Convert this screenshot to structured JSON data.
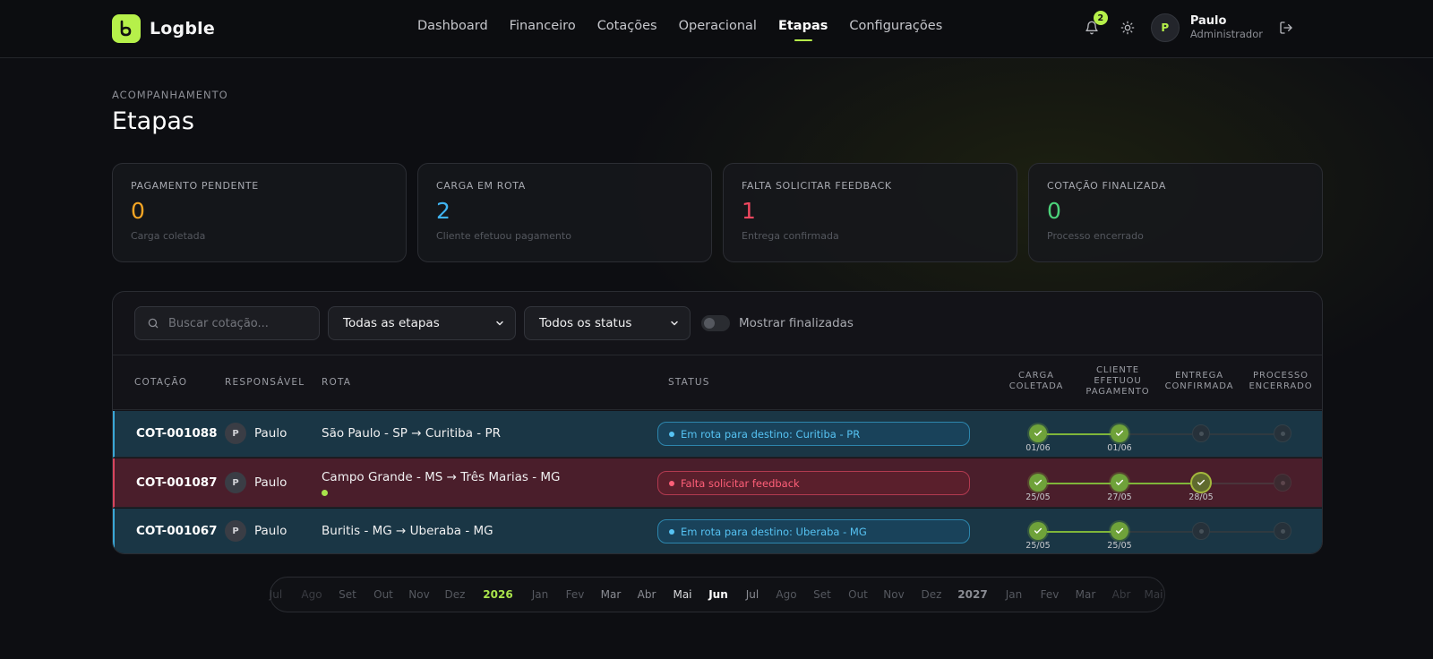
{
  "app": {
    "name": "Logble",
    "logo_icon": "logble-logo-icon",
    "accent": "#b6f04a"
  },
  "nav": {
    "items": [
      {
        "label": "Dashboard",
        "active": false
      },
      {
        "label": "Financeiro",
        "active": false
      },
      {
        "label": "Cotações",
        "active": false
      },
      {
        "label": "Operacional",
        "active": false
      },
      {
        "label": "Etapas",
        "active": true
      },
      {
        "label": "Configurações",
        "active": false
      }
    ]
  },
  "header": {
    "notifications_count": "2",
    "user": {
      "initial": "P",
      "name": "Paulo",
      "role": "Administrador"
    }
  },
  "page": {
    "kicker": "ACOMPANHAMENTO",
    "title": "Etapas"
  },
  "cards": [
    {
      "label": "PAGAMENTO PENDENTE",
      "value": "0",
      "sub": "Carga coletada",
      "color": "#f5a524"
    },
    {
      "label": "CARGA EM ROTA",
      "value": "2",
      "sub": "Cliente efetuou pagamento",
      "color": "#3fb3f0"
    },
    {
      "label": "FALTA SOLICITAR FEEDBACK",
      "value": "1",
      "sub": "Entrega confirmada",
      "color": "#f0475f"
    },
    {
      "label": "COTAÇÃO FINALIZADA",
      "value": "0",
      "sub": "Processo encerrado",
      "color": "#4cd27a"
    }
  ],
  "filters": {
    "search_placeholder": "Buscar cotação...",
    "stage_select": "Todas as etapas",
    "status_select": "Todos os status",
    "toggle_label": "Mostrar finalizadas"
  },
  "table": {
    "headers": {
      "cotacao": "COTAÇÃO",
      "responsavel": "RESPONSÁVEL",
      "rota": "ROTA",
      "status": "STATUS"
    },
    "stage_headers": [
      "CARGA\nCOLETADA",
      "CLIENTE\nEFETUOU\nPAGAMENTO",
      "ENTREGA\nCONFIRMADA",
      "PROCESSO\nENCERRADO"
    ],
    "rows": [
      {
        "code": "COT-001088",
        "resp_initial": "P",
        "resp_name": "Paulo",
        "route": "São Paulo - SP → Curitiba - PR",
        "status": "Em rota para destino: Curitiba - PR",
        "tone": "blue",
        "stages": [
          "done",
          "done",
          "todo",
          "todo"
        ],
        "dates": [
          "01/06",
          "01/06",
          "",
          ""
        ],
        "has_dot": false
      },
      {
        "code": "COT-001087",
        "resp_initial": "P",
        "resp_name": "Paulo",
        "route": "Campo Grande - MS → Três Marias - MG",
        "status": "Falta solicitar feedback",
        "tone": "red",
        "stages": [
          "done",
          "done",
          "current",
          "todo"
        ],
        "dates": [
          "25/05",
          "27/05",
          "28/05",
          ""
        ],
        "has_dot": true
      },
      {
        "code": "COT-001067",
        "resp_initial": "P",
        "resp_name": "Paulo",
        "route": "Buritis - MG → Uberaba - MG",
        "status": "Em rota para destino: Uberaba - MG",
        "tone": "blue",
        "stages": [
          "done",
          "done",
          "todo",
          "todo"
        ],
        "dates": [
          "25/05",
          "25/05",
          "",
          ""
        ],
        "has_dot": false
      }
    ]
  },
  "timebar": {
    "items": [
      {
        "label": "Jul",
        "kind": "fade"
      },
      {
        "label": "Ago",
        "kind": "fade"
      },
      {
        "label": "Set",
        "kind": "dim"
      },
      {
        "label": "Out",
        "kind": "dim"
      },
      {
        "label": "Nov",
        "kind": "dim"
      },
      {
        "label": "Dez",
        "kind": "dim"
      },
      {
        "label": "2026",
        "kind": "year"
      },
      {
        "label": "Jan",
        "kind": "dim"
      },
      {
        "label": "Fev",
        "kind": "dim"
      },
      {
        "label": "Mar",
        "kind": "mid"
      },
      {
        "label": "Abr",
        "kind": "mid"
      },
      {
        "label": "Mai",
        "kind": "near"
      },
      {
        "label": "Jun",
        "kind": "cur"
      },
      {
        "label": "Jul",
        "kind": "mid"
      },
      {
        "label": "Ago",
        "kind": "dim"
      },
      {
        "label": "Set",
        "kind": "dim"
      },
      {
        "label": "Out",
        "kind": "dim"
      },
      {
        "label": "Nov",
        "kind": "dim"
      },
      {
        "label": "Dez",
        "kind": "dim"
      },
      {
        "label": "2027",
        "kind": "year2"
      },
      {
        "label": "Jan",
        "kind": "dim"
      },
      {
        "label": "Fev",
        "kind": "dim"
      },
      {
        "label": "Mar",
        "kind": "dim"
      },
      {
        "label": "Abr",
        "kind": "fade"
      },
      {
        "label": "Mai",
        "kind": "fade"
      }
    ]
  }
}
